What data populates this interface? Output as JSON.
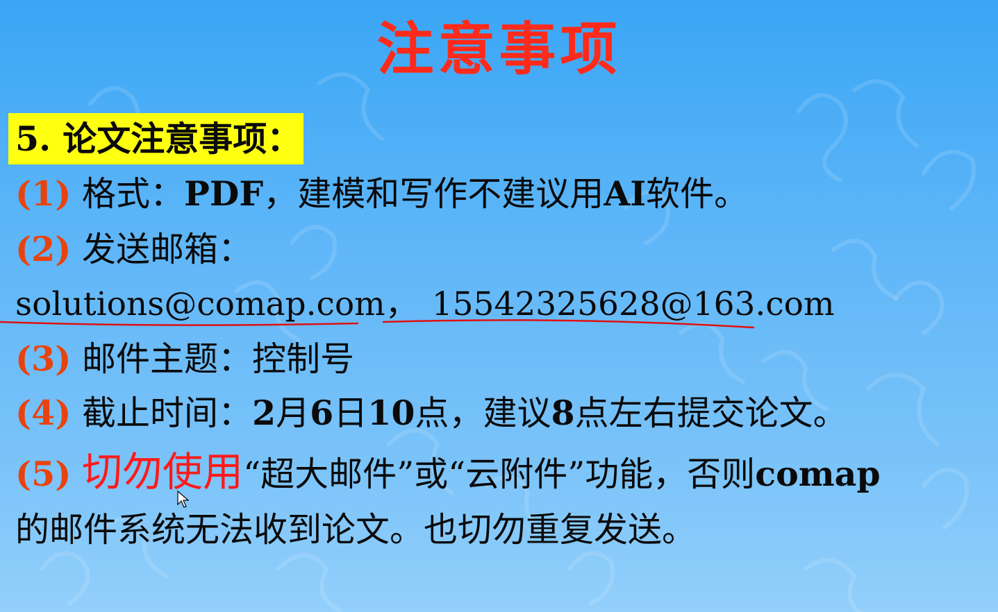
{
  "slide": {
    "title": "注意事项",
    "heading": "5. 论文注意事项：",
    "items": [
      {
        "num": "(1)",
        "pre": " 格式：",
        "bold": "PDF",
        "rest": "，建模和写作不建议用",
        "bold2": "AI",
        "tail": "软件。"
      },
      {
        "num": "(2)",
        "text": " 发送邮箱："
      },
      {
        "num": "(3)",
        "text": " 邮件主题：控制号"
      },
      {
        "num": "(4)",
        "pre": " 截止时间：",
        "b1": "2",
        "t1": "月",
        "b2": "6",
        "t2": "日",
        "b3": "10",
        "t3": "点，建议",
        "b4": "8",
        "t4": "点左右提交论文。"
      },
      {
        "num": "(5)",
        "red": "切勿使用",
        "rest": "“超大邮件”或“云附件”功能，否则",
        "bold": "comap"
      }
    ],
    "emails": {
      "first": "solutions@comap.com",
      "sep": "，",
      "second": "15542325628@163.com"
    },
    "item5_line2": "的邮件系统无法收到论文。也切勿重复发送。"
  },
  "colors": {
    "title": "#ff2a1a",
    "number": "#e8430e",
    "emphasis": "#ff1a1a",
    "highlight": "#ffff10",
    "underline": "#e01010"
  }
}
